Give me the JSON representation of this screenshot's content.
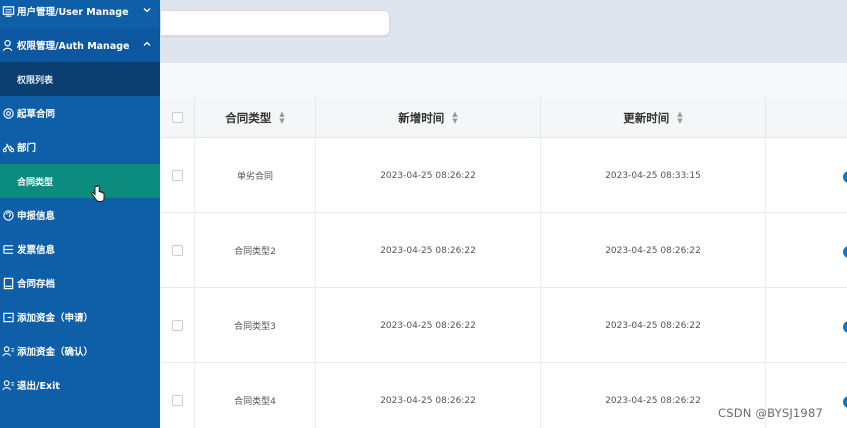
{
  "sidebar": {
    "items": [
      {
        "label": "用户管理/User Manage",
        "icon": "user-manage-icon",
        "expanded": false
      },
      {
        "label": "权限管理/Auth Manage",
        "icon": "auth-manage-icon",
        "expanded": true
      },
      {
        "label": "权限列表"
      },
      {
        "label": "起草合同",
        "icon": "draft-contract-icon"
      },
      {
        "label": "部门",
        "icon": "department-icon"
      },
      {
        "label": "合同类型",
        "active": true
      },
      {
        "label": "申报信息",
        "icon": "declare-info-icon"
      },
      {
        "label": "发票信息",
        "icon": "invoice-info-icon"
      },
      {
        "label": "合同存档",
        "icon": "contract-archive-icon"
      },
      {
        "label": "添加资金（申请）",
        "icon": "add-funds-apply-icon"
      },
      {
        "label": "添加资金（确认）",
        "icon": "add-funds-confirm-icon"
      },
      {
        "label": "退出/Exit",
        "icon": "exit-icon"
      }
    ]
  },
  "search": {
    "placeholder": ""
  },
  "table": {
    "headers": [
      "合同类型",
      "新增时间",
      "更新时间"
    ],
    "rows": [
      {
        "type": "单劣合同",
        "created": "2023-04-25 08:26:22",
        "updated": "2023-04-25 08:33:15"
      },
      {
        "type": "合同类型2",
        "created": "2023-04-25 08:26:22",
        "updated": "2023-04-25 08:26:22"
      },
      {
        "type": "合同类型3",
        "created": "2023-04-25 08:26:22",
        "updated": "2023-04-25 08:26:22"
      },
      {
        "type": "合同类型4",
        "created": "2023-04-25 08:26:22",
        "updated": "2023-04-25 08:26:22"
      }
    ]
  },
  "watermark": "CSDN @BYSJ1987",
  "colors": {
    "sidebar": "#0f5ea8",
    "sidebar_active": "#0c8b7f",
    "sidebar_sub_dark": "#0a3f70",
    "header_bg": "#dfe5ee"
  }
}
